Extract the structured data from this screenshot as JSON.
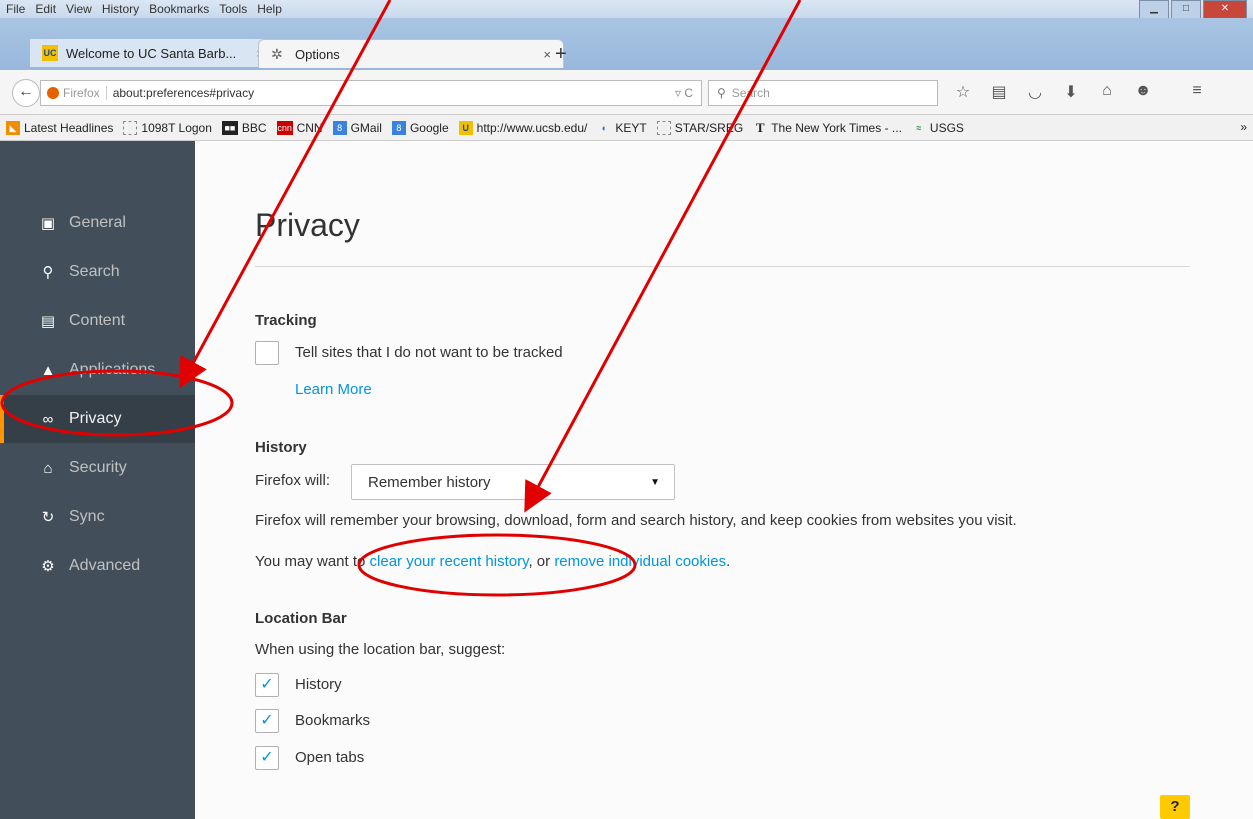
{
  "menubar": {
    "items": [
      "File",
      "Edit",
      "View",
      "History",
      "Bookmarks",
      "Tools",
      "Help"
    ]
  },
  "tabs": {
    "inactive_title": "Welcome to UC Santa Barb...",
    "active_title": "Options",
    "close_glyph": "×",
    "newtab_glyph": "+"
  },
  "navbar": {
    "identity_label": "Firefox",
    "url": "about:preferences#privacy",
    "url_right_glyphs": "▿ C",
    "search_placeholder": "Search"
  },
  "bookmarks": {
    "items": [
      {
        "label": "Latest Headlines",
        "icon": "rss-icon"
      },
      {
        "label": "1098T Logon",
        "icon": "page-icon"
      },
      {
        "label": "BBC",
        "icon": "bbc-icon"
      },
      {
        "label": "CNN",
        "icon": "cnn-icon"
      },
      {
        "label": "GMail",
        "icon": "google-icon"
      },
      {
        "label": "Google",
        "icon": "google-icon"
      },
      {
        "label": "http://www.ucsb.edu/",
        "icon": "ucsb-icon"
      },
      {
        "label": "KEYT",
        "icon": "keyt-icon"
      },
      {
        "label": "STAR/SREG",
        "icon": "page-icon"
      },
      {
        "label": "The New York Times - ...",
        "icon": "nyt-icon"
      },
      {
        "label": "USGS",
        "icon": "usgs-icon"
      }
    ],
    "overflow_glyph": "»"
  },
  "sidebar": {
    "items": [
      {
        "label": "General",
        "icon": "general-icon"
      },
      {
        "label": "Search",
        "icon": "search-icon"
      },
      {
        "label": "Content",
        "icon": "content-icon"
      },
      {
        "label": "Applications",
        "icon": "applications-icon"
      },
      {
        "label": "Privacy",
        "icon": "privacy-mask-icon"
      },
      {
        "label": "Security",
        "icon": "security-icon"
      },
      {
        "label": "Sync",
        "icon": "sync-icon"
      },
      {
        "label": "Advanced",
        "icon": "advanced-icon"
      }
    ],
    "selected": "Privacy"
  },
  "main": {
    "title": "Privacy",
    "tracking": {
      "heading": "Tracking",
      "dnt_label": "Tell sites that I do not want to be tracked",
      "dnt_checked": false,
      "learn_more": "Learn More"
    },
    "history": {
      "heading": "History",
      "firefox_will_label": "Firefox will:",
      "select_value": "Remember history",
      "description": "Firefox will remember your browsing, download, form and search history, and keep cookies from websites you visit.",
      "may_want_prefix": "You may want to ",
      "clear_link": "clear your recent history",
      "or_text": ", or ",
      "remove_link": "remove individual cookies",
      "period": "."
    },
    "location_bar": {
      "heading": "Location Bar",
      "intro": "When using the location bar, suggest:",
      "options": [
        {
          "label": "History",
          "checked": true
        },
        {
          "label": "Bookmarks",
          "checked": true
        },
        {
          "label": "Open tabs",
          "checked": true
        }
      ]
    },
    "help_label": "?"
  },
  "colors": {
    "sidebar_bg": "#424f5a",
    "accent_orange": "#ff9500",
    "link_blue": "#0095dd",
    "annotation_red": "#e00000"
  }
}
